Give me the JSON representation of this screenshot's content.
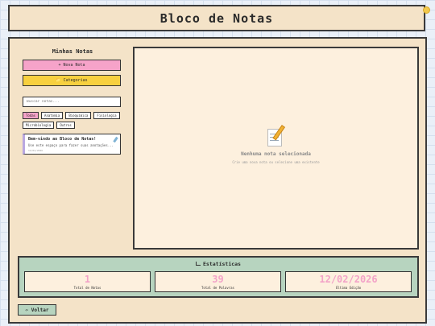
{
  "header": {
    "title": "Bloco de Notas"
  },
  "sidebar": {
    "title": "Minhas Notas",
    "new_note_label": "+ Nova Nota",
    "categories_label": "📁 Categorias",
    "search_placeholder": "Buscar notas...",
    "tags": [
      "Todas",
      "Anatomia",
      "Bioquímica",
      "Fisiologia",
      "Microbiologia",
      "Outros"
    ],
    "active_tag": "Todas",
    "notes": [
      {
        "title": "Bem-vindo ao Bloco de Notas!",
        "preview": "Use este espaço para fazer suas anotações...",
        "date": "12/02/2026"
      }
    ]
  },
  "editor": {
    "empty_title": "Nenhuma nota selecionada",
    "empty_subtitle": "Crie uma nova nota ou selecione uma existente"
  },
  "stats": {
    "title": "Estatísticas",
    "items": [
      {
        "value": "1",
        "label": "Total de Notas"
      },
      {
        "value": "39",
        "label": "Total de Palavras"
      },
      {
        "value": "12/02/2026",
        "label": "Última Edição"
      }
    ]
  },
  "back_label": "⇦ Voltar",
  "colors": {
    "accent_pink": "#f6a3c9",
    "accent_yellow": "#f7d03f",
    "accent_green": "#b7d4bf",
    "panel": "#f4e3c8"
  }
}
